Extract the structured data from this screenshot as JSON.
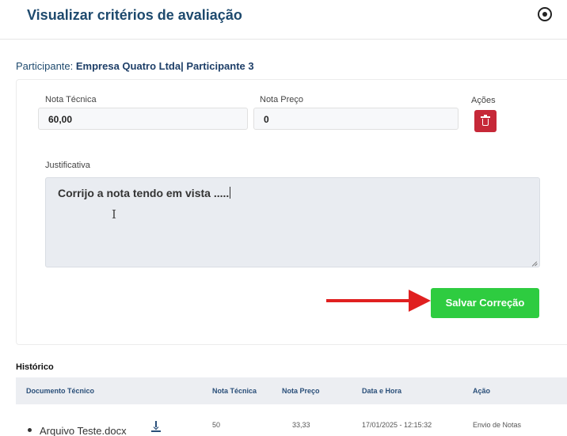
{
  "modal": {
    "title": "Visualizar critérios de avaliação",
    "close_icon": "close-circle-icon"
  },
  "participant": {
    "label": "Participante:",
    "value": "Empresa Quatro Ltda| Participante 3"
  },
  "form": {
    "nota_tecnica_label": "Nota Técnica",
    "nota_tecnica_value": "60,00",
    "nota_preco_label": "Nota Preço",
    "nota_preco_value": "0",
    "acoes_label": "Ações",
    "delete_icon": "trash-icon",
    "justificativa_label": "Justificativa",
    "justificativa_value": "Corrijo a nota tendo em vista .....",
    "save_label": "Salvar Correção",
    "accent_color": "#2ecc40",
    "danger_color": "#c62838",
    "annotation_arrow_color": "#e02020"
  },
  "history": {
    "title": "Histórico",
    "columns": [
      "Documento Técnico",
      "Nota Técnica",
      "Nota Preço",
      "Data e Hora",
      "Ação"
    ],
    "rows": [
      {
        "document": "Arquivo Teste.docx",
        "download_icon": "download-icon",
        "nota_tecnica": "50",
        "nota_preco": "33,33",
        "data_hora": "17/01/2025 - 12:15:32",
        "acao": "Envio de Notas"
      }
    ]
  }
}
